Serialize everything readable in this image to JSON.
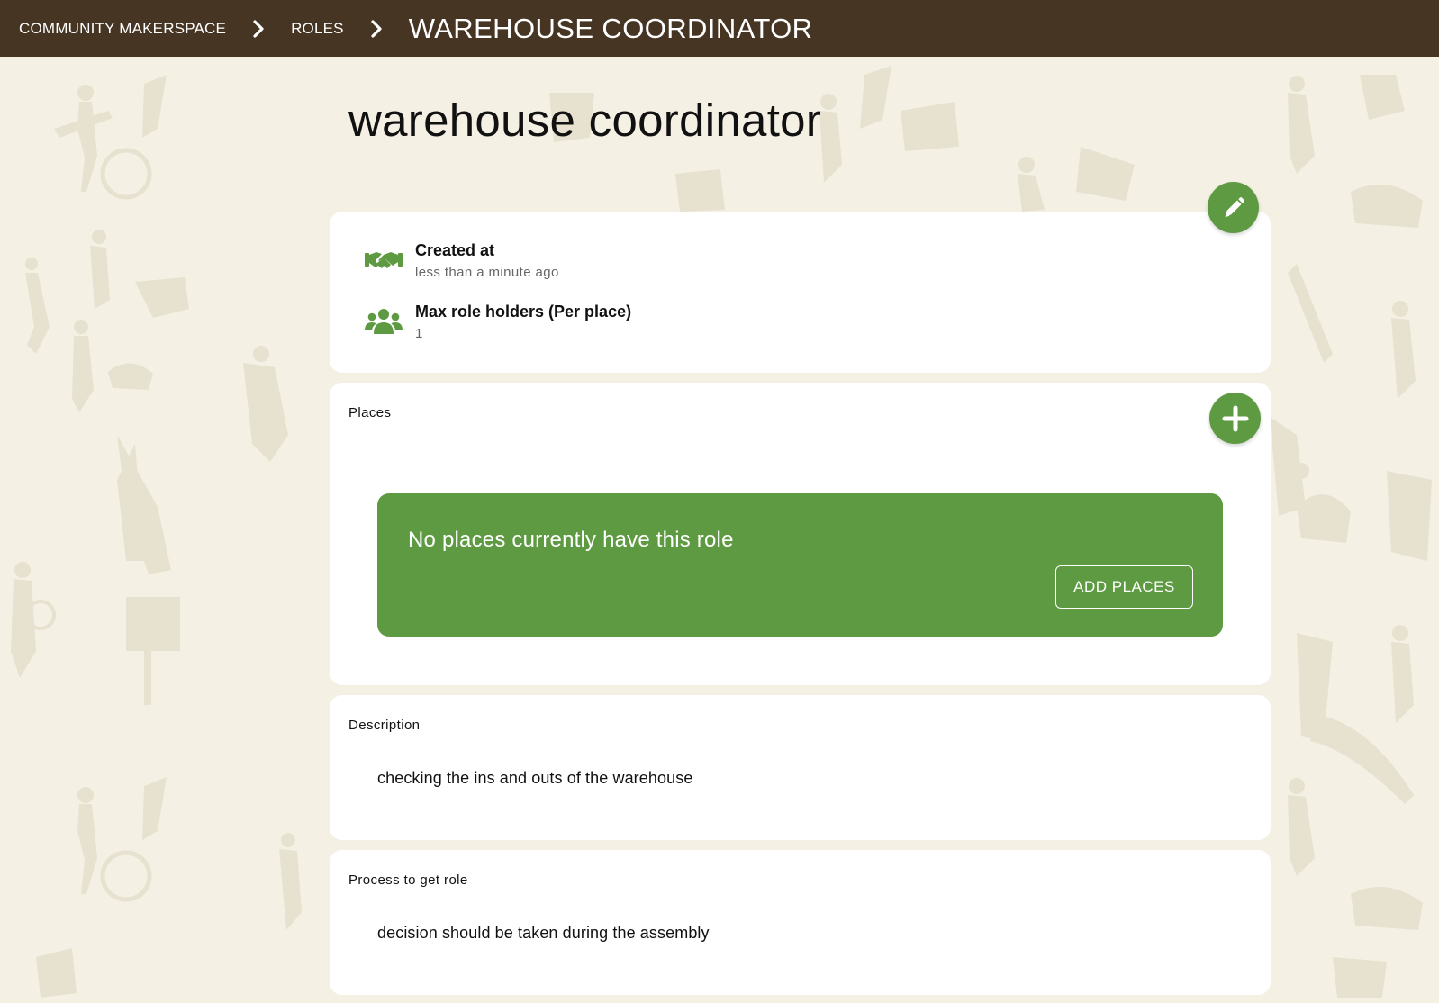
{
  "colors": {
    "topbar": "#463523",
    "accent": "#5e9a41",
    "background": "#f4f0e4",
    "card": "#ffffff"
  },
  "breadcrumb": {
    "items": [
      "COMMUNITY MAKERSPACE",
      "ROLES"
    ],
    "current": "WAREHOUSE COORDINATOR",
    "separator_icon": "chevron-right-icon"
  },
  "page": {
    "title": "warehouse coordinator"
  },
  "edit_button": {
    "icon": "pencil-icon"
  },
  "info": {
    "created_at": {
      "icon": "handshake-icon",
      "label": "Created at",
      "value": "less than a minute ago"
    },
    "max_role_holders": {
      "icon": "users-icon",
      "label": "Max role holders (Per place)",
      "value": "1"
    }
  },
  "places": {
    "label": "Places",
    "add_icon": "plus-icon",
    "empty_message": "No places currently have this role",
    "add_button_label": "ADD PLACES"
  },
  "description": {
    "label": "Description",
    "text": "checking the ins and outs of the warehouse"
  },
  "process": {
    "label": "Process to get role",
    "text": "decision should be taken during the assembly"
  }
}
